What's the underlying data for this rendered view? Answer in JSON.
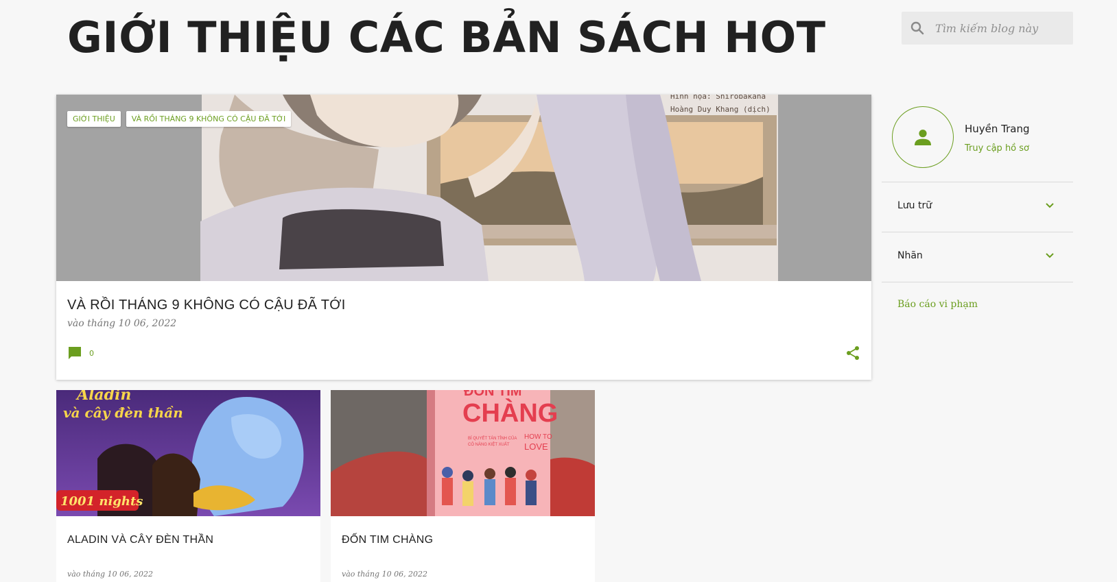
{
  "header": {
    "blog_title": "GIỚI THIỆU CÁC BẢN SÁCH HOT"
  },
  "search": {
    "placeholder": "Tìm kiếm blog này",
    "icon": "search-icon"
  },
  "featured_post": {
    "labels": [
      "GIỚI THIỆU",
      "VÀ RỒI THÁNG 9 KHÔNG CÓ CẬU ĐÃ TỚI"
    ],
    "title": "VÀ RỒI THÁNG 9 KHÔNG CÓ CẬU ĐÃ TỚI",
    "date": "vào tháng 10 06, 2022",
    "comment_count": "0",
    "image_text": [
      "Hình họa: Shirobakaha",
      "Hoàng Duy Khang (dịch)"
    ]
  },
  "posts": [
    {
      "title": "ALADIN VÀ CÂY ĐÈN THẦN",
      "date": "vào tháng 10 06, 2022",
      "image_text": [
        "Aladin",
        "và cây đèn thần",
        "1001 nights"
      ]
    },
    {
      "title": "ĐỐN TIM CHÀNG",
      "date": "vào tháng 10 06, 2022",
      "image_text": [
        "ĐỐN TIM",
        "CHÀNG",
        "BÍ QUYẾT TÁN TỈNH CỦA",
        "CÔ NÀNG KIỆT XUẤT",
        "HOW TO",
        "LOVE"
      ]
    }
  ],
  "sidebar": {
    "profile_name": "Huyền Trang",
    "profile_link": "Truy cập hồ sơ",
    "sections": [
      "Lưu trữ",
      "Nhãn"
    ],
    "report_link": "Báo cáo vi phạm"
  },
  "colors": {
    "accent": "#6b9e1f",
    "background": "#f7f7f7",
    "text": "#212121",
    "muted": "#757575"
  }
}
